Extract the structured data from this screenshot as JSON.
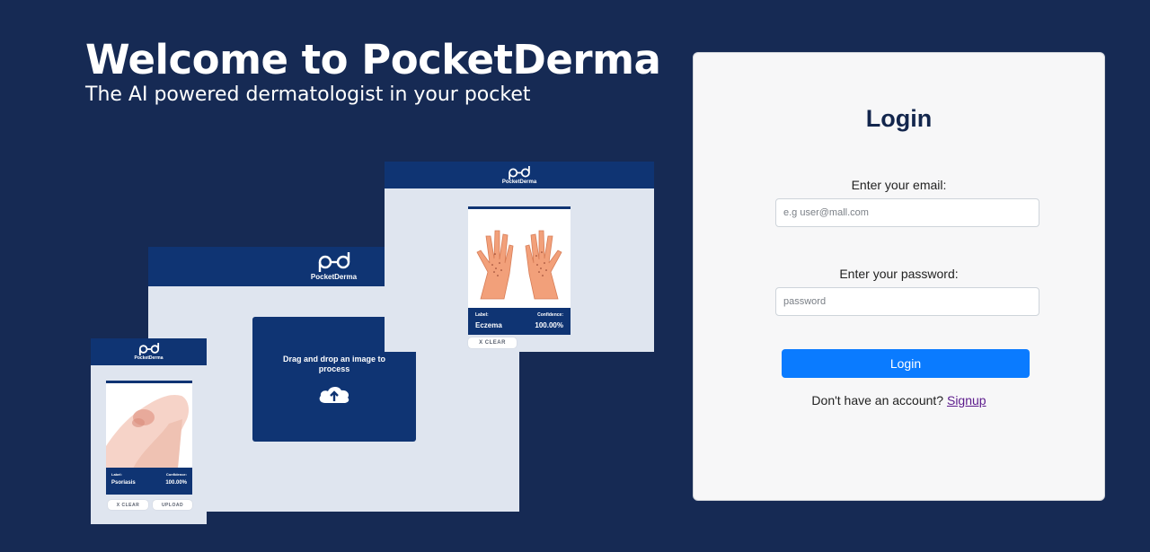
{
  "hero": {
    "title": "Welcome to PocketDerma",
    "subtitle": "The AI powered dermatologist in your pocket"
  },
  "mockups": {
    "brand": "PocketDerma",
    "dropzone_text": "Drag and drop an image to process",
    "eczema_card": {
      "label_caption": "Label:",
      "label_value": "Eczema",
      "confidence_caption": "Confidence:",
      "confidence_value": "100.00%",
      "clear_button": "X CLEAR"
    },
    "psoriasis_card": {
      "label_caption": "Label:",
      "label_value": "Psoriasis",
      "confidence_caption": "Confidence:",
      "confidence_value": "100.00%",
      "clear_button": "X CLEAR",
      "upload_button": "UPLOAD"
    }
  },
  "login": {
    "title": "Login",
    "email_label": "Enter your email:",
    "email_placeholder": "e.g user@mall.com",
    "password_label": "Enter your password:",
    "password_placeholder": "password",
    "button_label": "Login",
    "signup_prompt": "Don't have an account?",
    "signup_link": "Signup"
  },
  "colors": {
    "background": "#162a54",
    "mock_header": "#0f3473",
    "button": "#0a7bff"
  }
}
